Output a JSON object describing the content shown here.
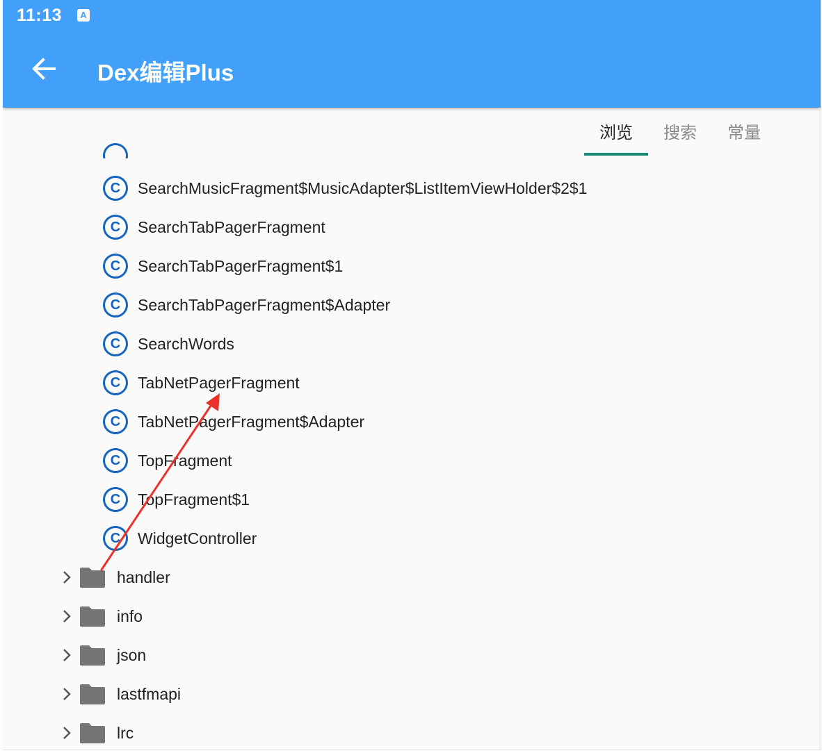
{
  "status_bar": {
    "time": "11:13",
    "notification_icon": "A"
  },
  "app_bar": {
    "back_icon": "arrow-left-icon",
    "title": "Dex编辑Plus"
  },
  "tabs": [
    {
      "label": "浏览",
      "active": true
    },
    {
      "label": "搜索",
      "active": false
    },
    {
      "label": "常量",
      "active": false
    }
  ],
  "class_items": [
    {
      "icon": "C",
      "label": "SearchMusicFragment$MusicAdapter$ListItemViewHolder$2$1"
    },
    {
      "icon": "C",
      "label": "SearchTabPagerFragment"
    },
    {
      "icon": "C",
      "label": "SearchTabPagerFragment$1"
    },
    {
      "icon": "C",
      "label": "SearchTabPagerFragment$Adapter"
    },
    {
      "icon": "C",
      "label": "SearchWords"
    },
    {
      "icon": "C",
      "label": "TabNetPagerFragment"
    },
    {
      "icon": "C",
      "label": "TabNetPagerFragment$Adapter"
    },
    {
      "icon": "C",
      "label": "TopFragment"
    },
    {
      "icon": "C",
      "label": "TopFragment$1"
    },
    {
      "icon": "C",
      "label": "WidgetController"
    }
  ],
  "folder_items": [
    {
      "label": "handler"
    },
    {
      "label": "info"
    },
    {
      "label": "json"
    },
    {
      "label": "lastfmapi"
    },
    {
      "label": "lrc"
    }
  ],
  "colors": {
    "app_bar": "#42a0fb",
    "class_icon": "#1565c0",
    "tab_indicator": "#1a8a76",
    "folder_icon": "#757575",
    "annotation_arrow": "#e8322a"
  }
}
